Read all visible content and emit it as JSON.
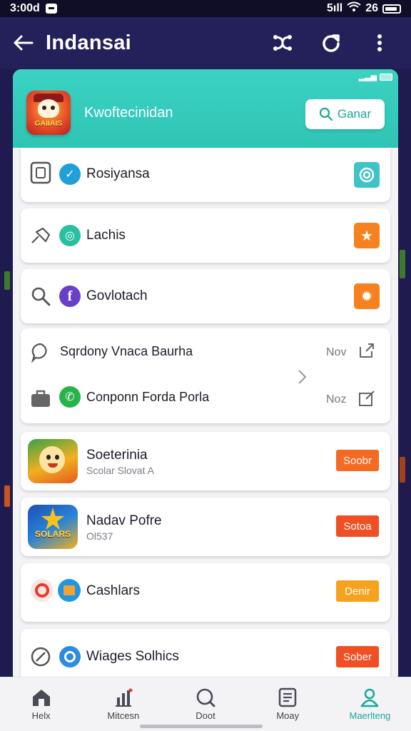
{
  "status_bar": {
    "time": "3:00d",
    "right_text": "5ıll",
    "clock": "26"
  },
  "app_bar": {
    "title": "Indansai",
    "back_icon": "arrow-left-icon",
    "actions": [
      "shuffle-icon",
      "refresh-icon",
      "more-vert-icon"
    ]
  },
  "header": {
    "app_logo_text": "GAIIAIS",
    "title": "Kwoftecinidan",
    "button_label": "Ganar",
    "button_icon": "search-icon"
  },
  "rows": [
    {
      "label": "Rosiyansa",
      "lead_icon": "tablet-icon",
      "round_icon": "check-badge-icon",
      "round_color": "#20a0d8",
      "trail_icon": "target-icon",
      "trail_color": "#3fc3c7"
    },
    {
      "label": "Lachis",
      "lead_icon": "pin-icon",
      "round_icon": "chat-icon",
      "round_color": "#28c0a2",
      "trail_icon": "star-icon",
      "trail_color": "#f6821f"
    },
    {
      "label": "Govlotach",
      "lead_icon": "search-icon",
      "round_icon": "facebook-icon",
      "round_color": "#6a3fc8",
      "trail_icon": "gear-icon",
      "trail_color": "#f6821f"
    }
  ],
  "double_card": {
    "items": [
      {
        "label": "Sqrdony Vnaca Baurha",
        "meta": "Nov",
        "lead_icon": "chat-bubble-icon",
        "trail_icon": "share-icon"
      },
      {
        "label": "Conponn Forda Porla",
        "meta": "Noz",
        "lead_icon": "briefcase-icon",
        "round_icon": "phone-icon",
        "round_color": "#28b34a",
        "trail_icon": "edit-icon"
      }
    ],
    "chevron_icon": "chevron-right-icon"
  },
  "games": [
    {
      "title": "Soeterinia",
      "sub": "Scolar Slovat A",
      "button": "Soobr",
      "button_color": "#f56a22"
    },
    {
      "title": "Nadav Pofre",
      "sub": "Ol537",
      "button": "Sotoa",
      "button_color": "#f04f23",
      "thumb_text": "SOLARS"
    },
    {
      "title": "Cashlars",
      "sub": "",
      "button": "Denir",
      "button_color": "#f6a21c"
    },
    {
      "title": "Wiages Solhics",
      "sub": "",
      "button": "Sober",
      "button_color": "#f04f23"
    }
  ],
  "bottom_nav": [
    {
      "label": "Helx",
      "icon": "home-icon"
    },
    {
      "label": "Mitcesn",
      "icon": "chart-icon"
    },
    {
      "label": "Doot",
      "icon": "search-icon"
    },
    {
      "label": "Moay",
      "icon": "document-icon"
    },
    {
      "label": "Maerlteng",
      "icon": "person-icon",
      "active": true
    }
  ],
  "colors": {
    "accent": "#2fc4b4",
    "app_bar": "#24215a",
    "background": "#1f1b4f"
  }
}
